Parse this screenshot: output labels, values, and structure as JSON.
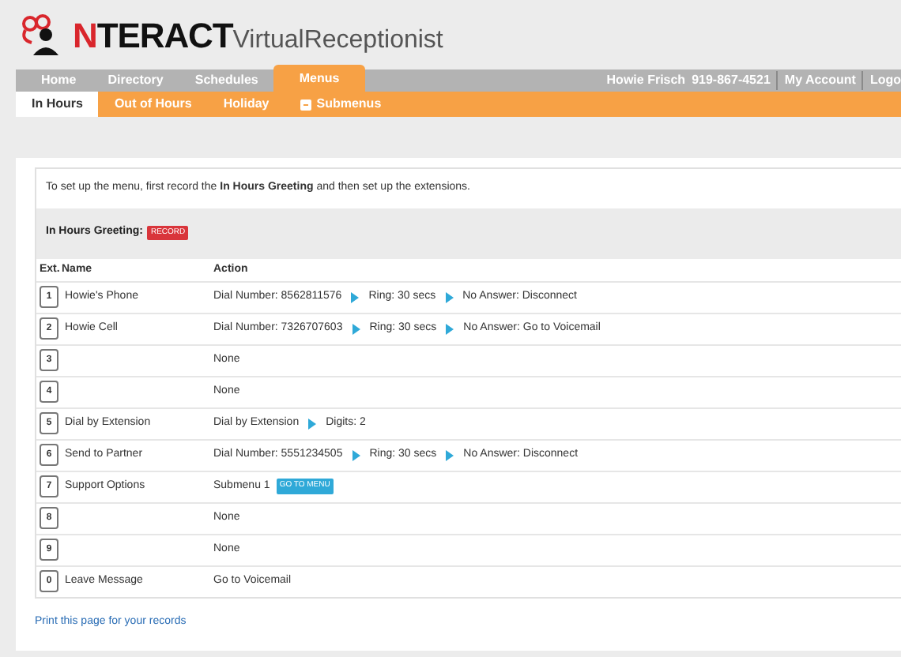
{
  "logo": {
    "accent": "N",
    "rest": "TERACT",
    "suffix": "VirtualReceptionist"
  },
  "nav": {
    "tabs": [
      {
        "label": "Home",
        "selected": false
      },
      {
        "label": "Directory",
        "selected": false
      },
      {
        "label": "Schedules",
        "selected": false
      },
      {
        "label": "Menus",
        "selected": true
      }
    ],
    "user": "Howie Frisch",
    "phone": "919-867-4521",
    "links": [
      "My Account",
      "Logo"
    ]
  },
  "subnav": [
    {
      "label": "In Hours",
      "selected": true,
      "icon": false
    },
    {
      "label": "Out of Hours",
      "selected": false,
      "icon": false
    },
    {
      "label": "Holiday",
      "selected": false,
      "icon": false
    },
    {
      "label": "Submenus",
      "selected": false,
      "icon": true
    }
  ],
  "instruction": "To set up the menu, first record the **In Hours Greeting** and then set up the extensions.",
  "greeting": {
    "label": "In Hours Greeting:",
    "button": "RECORD"
  },
  "table": {
    "columns": [
      "Ext.",
      "Name",
      "Action"
    ],
    "rows": [
      {
        "ext": "1",
        "name": "Howie's Phone",
        "steps": [
          "Dial Number: 8562811576",
          "Ring: 30 secs",
          "No Answer: Disconnect"
        ]
      },
      {
        "ext": "2",
        "name": "Howie Cell",
        "steps": [
          "Dial Number: 7326707603",
          "Ring: 30 secs",
          "No Answer: Go to Voicemail"
        ]
      },
      {
        "ext": "3",
        "steps": [
          "None"
        ]
      },
      {
        "ext": "4",
        "steps": [
          "None"
        ]
      },
      {
        "ext": "5",
        "name": "Dial by Extension",
        "steps": [
          "Dial by Extension",
          "Digits: 2"
        ]
      },
      {
        "ext": "6",
        "name": "Send to Partner",
        "steps": [
          "Dial Number: 5551234505",
          "Ring: 30 secs",
          "No Answer: Disconnect"
        ]
      },
      {
        "ext": "7",
        "name": "Support Options",
        "steps": [
          "Submenu 1"
        ],
        "button": "GO TO MENU"
      },
      {
        "ext": "8",
        "steps": [
          "None"
        ]
      },
      {
        "ext": "9",
        "steps": [
          "None"
        ]
      },
      {
        "ext": "0",
        "name": "Leave Message",
        "steps": [
          "Go to Voicemail"
        ]
      }
    ]
  },
  "print_link": "Print this page for your records"
}
